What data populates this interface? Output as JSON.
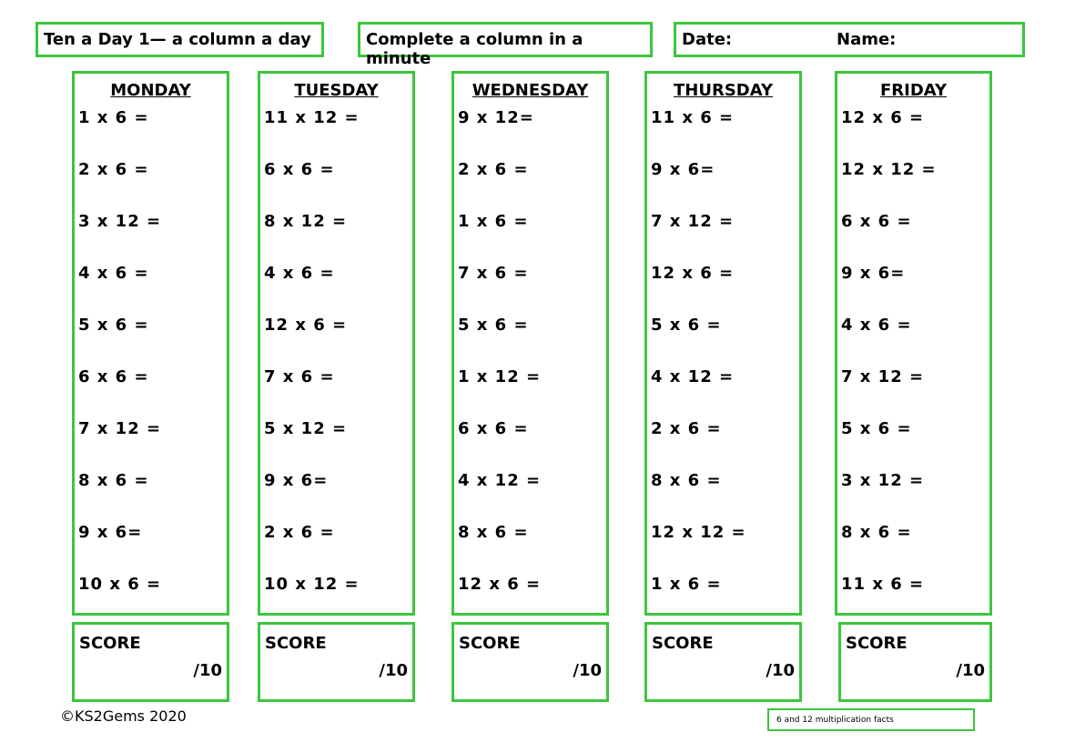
{
  "header": {
    "title": "Ten a Day 1— a column a day",
    "instruction": "Complete a column in a minute",
    "date_label": "Date:",
    "name_label": "Name:"
  },
  "accent_color": "#3cc63c",
  "columns": [
    {
      "day": "MONDAY",
      "questions": [
        "1 x 6 =",
        "2 x 6 =",
        "3 x 12 =",
        "4 x 6 =",
        "5 x 6 =",
        "6 x 6 =",
        "7 x 12 =",
        "8 x 6 =",
        "9 x 6=",
        "10 x 6 ="
      ]
    },
    {
      "day": "TUESDAY",
      "questions": [
        "11 x 12 =",
        "6 x 6 =",
        "8 x 12 =",
        "4 x 6 =",
        "12 x 6 =",
        "7 x 6 =",
        "5 x 12 =",
        "9 x 6=",
        "2 x 6 =",
        "10 x 12 ="
      ]
    },
    {
      "day": "WEDNESDAY",
      "questions": [
        "9 x 12=",
        "2 x 6 =",
        "1 x 6 =",
        "7 x 6 =",
        "5 x 6 =",
        "1 x 12 =",
        "6 x 6 =",
        "4 x 12 =",
        "8 x 6 =",
        "12 x 6 ="
      ]
    },
    {
      "day": "THURSDAY",
      "questions": [
        "11 x 6 =",
        "9 x 6=",
        "7 x 12 =",
        "12 x 6 =",
        "5 x 6 =",
        "4 x 12 =",
        "2 x 6 =",
        "8 x 6 =",
        "12 x 12 =",
        "1 x 6 ="
      ]
    },
    {
      "day": "FRIDAY",
      "questions": [
        "12 x 6 =",
        "12 x 12 =",
        "6 x 6 =",
        "9 x 6=",
        "4 x 6 =",
        "7 x 12 =",
        "5 x 6 =",
        "3 x 12 =",
        "8 x 6 =",
        "11 x 6 ="
      ]
    }
  ],
  "score": {
    "label": "SCORE",
    "out_of": "/10"
  },
  "footer": {
    "copyright": "©KS2Gems 2020",
    "topic": "6 and 12 multiplication facts"
  }
}
